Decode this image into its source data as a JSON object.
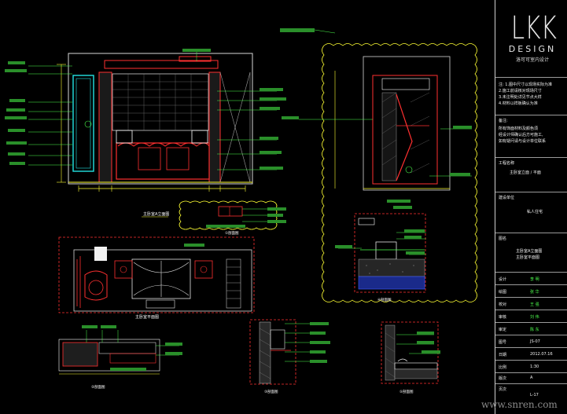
{
  "drawing": {
    "captions": {
      "elevation_a": "主卧室A立面图",
      "plan": "主卧室平面图",
      "section_1": "①剖面图",
      "section_2": "②剖面图",
      "section_3": "③剖面图",
      "section_4": "④剖面图",
      "section_5": "⑤剖面图"
    },
    "annotation_label": "装饰材料标注",
    "dimension_label": "尺寸"
  },
  "title_block": {
    "logo": "LKK",
    "logo_sub": "DESIGN",
    "logo_cn": "洛可可室内设计",
    "notes": [
      "注: 1.图中尺寸以现场实际为准",
      "2.施工前请核对现场尺寸",
      "3.未注明处详见节点大样",
      "4.材料以样板确认为准"
    ],
    "remark_label": "备注:",
    "remark_lines": [
      "所有饰面材料及颜色须",
      "经设计师确认后方可施工,",
      "如有疑问请与设计单位联系"
    ],
    "project_label": "工程名称",
    "project_value": "主卧室立面 / 平面",
    "client_label": "建设单位",
    "client_value": "私人住宅",
    "drawing_label": "图名",
    "drawing_value": "主卧室A立面图",
    "drawing_value2": "主卧室平面图",
    "rows": [
      {
        "label": "设计",
        "value": "李 明"
      },
      {
        "label": "绘图",
        "value": "张 华"
      },
      {
        "label": "校对",
        "value": "王 强"
      },
      {
        "label": "审核",
        "value": "刘 伟"
      },
      {
        "label": "审定",
        "value": "陈 东"
      },
      {
        "label": "图号",
        "value": "JS-07"
      },
      {
        "label": "日期",
        "value": "2012.07.16"
      },
      {
        "label": "比例",
        "value": "1:30"
      },
      {
        "label": "版次",
        "value": "A"
      }
    ],
    "sheet_label": "页次",
    "sheet_value": "L-17"
  },
  "watermark": "www.snren.com"
}
